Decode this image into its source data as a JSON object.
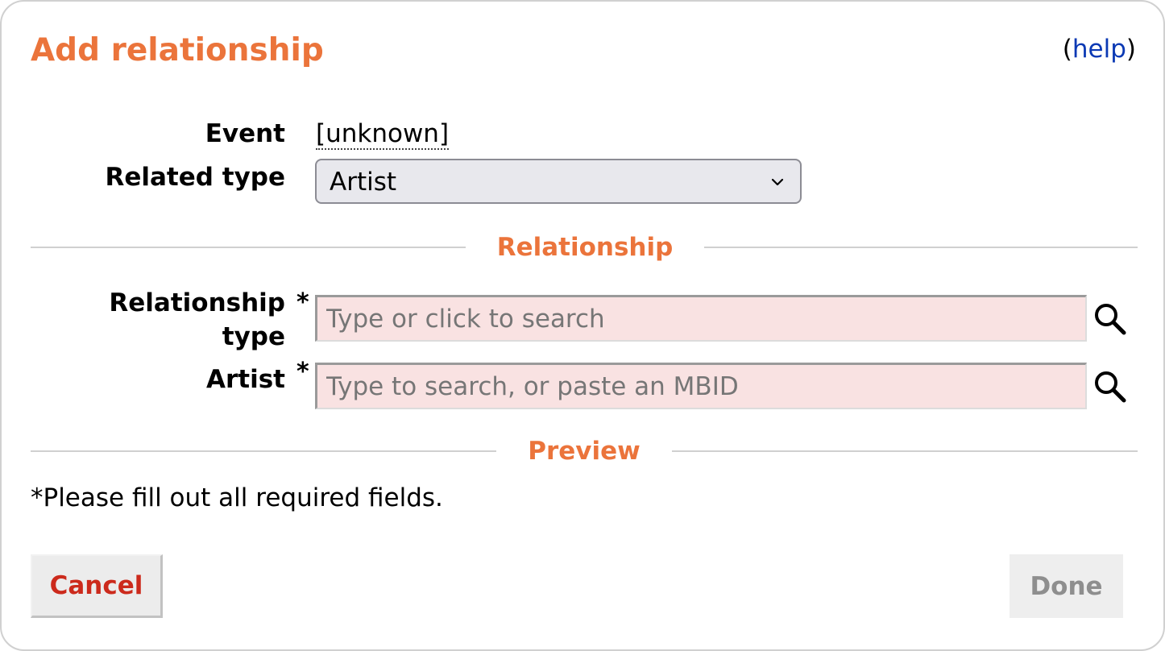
{
  "dialog": {
    "title": "Add relationship",
    "help_open": "(",
    "help_link": "help",
    "help_close": ")"
  },
  "form": {
    "event_label": "Event",
    "event_value": "[unknown]",
    "related_type_label": "Related type",
    "related_type_value": "Artist"
  },
  "sections": {
    "relationship": "Relationship",
    "preview": "Preview"
  },
  "relationship": {
    "type_label_line1": "Relationship",
    "type_label_line2": "type",
    "type_placeholder": "Type or click to search",
    "artist_label": "Artist",
    "artist_placeholder": "Type to search, or paste an MBID",
    "required_mark": "*"
  },
  "preview": {
    "hint": "*Please fill out all required fields."
  },
  "buttons": {
    "cancel": "Cancel",
    "done": "Done"
  },
  "colors": {
    "accent": "#eb743b",
    "link": "#0b39b4",
    "cancel": "#cc2a1c",
    "required_field_bg": "#f9e2e2",
    "disabled_text": "#8e8e8e"
  },
  "icons": {
    "search": "search-icon",
    "dropdown": "chevron-down-icon"
  }
}
